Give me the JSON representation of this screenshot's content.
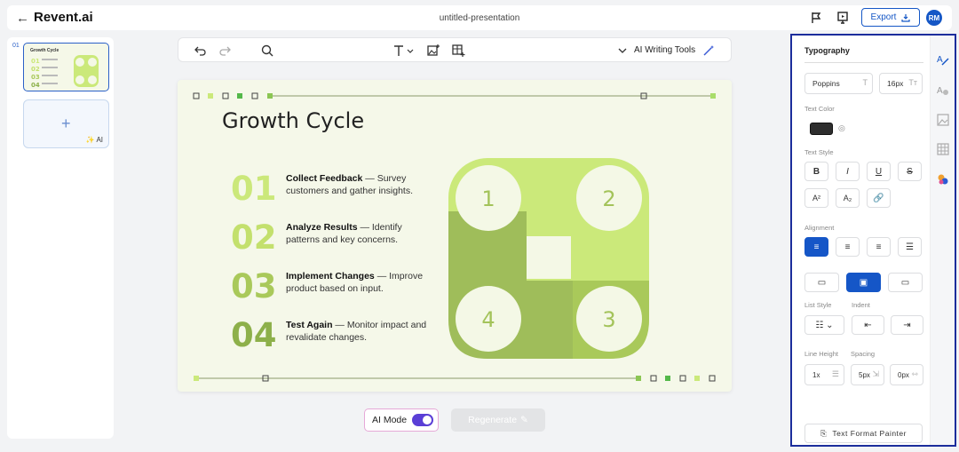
{
  "app": {
    "brand": "Revent.ai",
    "doc_title": "untitled-presentation",
    "export_label": "Export",
    "avatar_initials": "RM"
  },
  "slides_panel": {
    "slide_number": "01",
    "thumb_title": "Growth Cycle",
    "add_ai_label": "AI"
  },
  "toolbar": {
    "ai_tools_label": "AI Writing Tools"
  },
  "slide": {
    "title": "Growth Cycle",
    "steps": [
      {
        "num": "01",
        "heading": "Collect Feedback",
        "desc": " — Survey customers and gather insights.",
        "color": "#cbe87a"
      },
      {
        "num": "02",
        "heading": "Analyze Results",
        "desc": " — Identify patterns and key concerns.",
        "color": "#c3e06d"
      },
      {
        "num": "03",
        "heading": "Implement Changes",
        "desc": " — Improve product based on input.",
        "color": "#a9c95a"
      },
      {
        "num": "04",
        "heading": "Test Again",
        "desc": " — Monitor impact and revalidate changes.",
        "color": "#8db04a"
      }
    ],
    "cycle_labels": [
      "1",
      "2",
      "3",
      "4"
    ],
    "colors": {
      "light": "#cbe97a",
      "dark": "#9fbd5a",
      "circle": "#f4f8e6",
      "accent": "#54b84a",
      "circle_text": "#a3c35a"
    }
  },
  "bottom": {
    "ai_mode_label": "AI Mode",
    "ai_mode_on": true,
    "regenerate_label": "Regenerate"
  },
  "typography": {
    "title": "Typography",
    "font_family": "Poppins",
    "font_size": "16px",
    "text_color_label": "Text Color",
    "text_color": "#2e2e2e",
    "text_style_label": "Text Style",
    "style_buttons": [
      "B",
      "I",
      "U",
      "S"
    ],
    "script_buttons": [
      "A²",
      "A₂"
    ],
    "alignment_label": "Alignment",
    "list_style_label": "List Style",
    "indent_label": "Indent",
    "line_height_label": "Line Height",
    "spacing_label": "Spacing",
    "line_height": "1x",
    "spacing": "5px",
    "letter_spacing": "0px",
    "painter_label": "Text Format Painter"
  }
}
